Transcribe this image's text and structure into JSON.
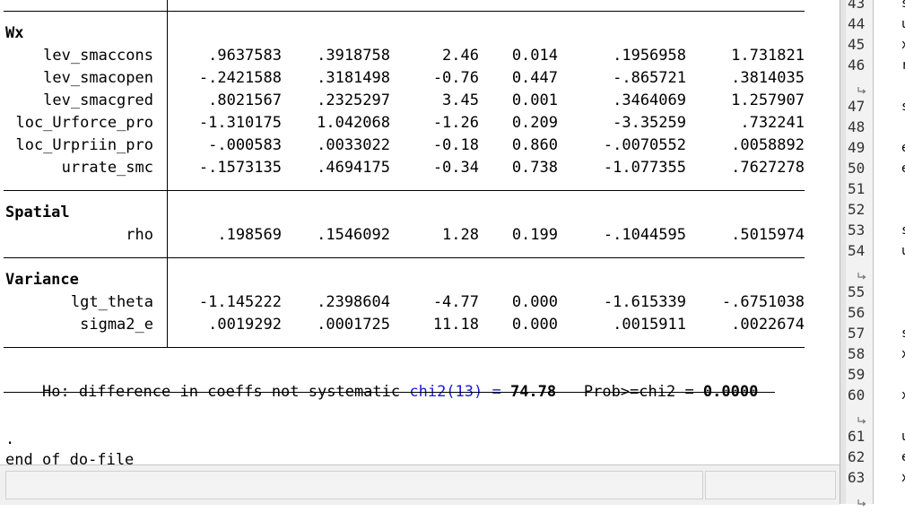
{
  "results": {
    "sections": [
      {
        "title": "Wx",
        "rows": [
          {
            "name": "lev_smaccons",
            "coef": ".9637583",
            "se": ".3918758",
            "z": "2.46",
            "p": "0.014",
            "ci_low": ".1956958",
            "ci_high": "1.731821"
          },
          {
            "name": "lev_smacopen",
            "coef": "-.2421588",
            "se": ".3181498",
            "z": "-0.76",
            "p": "0.447",
            "ci_low": "-.865721",
            "ci_high": ".3814035"
          },
          {
            "name": "lev_smacgred",
            "coef": ".8021567",
            "se": ".2325297",
            "z": "3.45",
            "p": "0.001",
            "ci_low": ".3464069",
            "ci_high": "1.257907"
          },
          {
            "name": "loc_Urforce_pro",
            "coef": "-1.310175",
            "se": "1.042068",
            "z": "-1.26",
            "p": "0.209",
            "ci_low": "-3.35259",
            "ci_high": ".732241"
          },
          {
            "name": "loc_Urpriin_pro",
            "coef": "-.000583",
            "se": ".0033022",
            "z": "-0.18",
            "p": "0.860",
            "ci_low": "-.0070552",
            "ci_high": ".0058892"
          },
          {
            "name": "urrate_smc",
            "coef": "-.1573135",
            "se": ".4694175",
            "z": "-0.34",
            "p": "0.738",
            "ci_low": "-1.077355",
            "ci_high": ".7627278"
          }
        ]
      },
      {
        "title": "Spatial",
        "rows": [
          {
            "name": "rho",
            "coef": ".198569",
            "se": ".1546092",
            "z": "1.28",
            "p": "0.199",
            "ci_low": "-.1044595",
            "ci_high": ".5015974"
          }
        ]
      },
      {
        "title": "Variance",
        "rows": [
          {
            "name": "lgt_theta",
            "coef": "-1.145222",
            "se": ".2398604",
            "z": "-4.77",
            "p": "0.000",
            "ci_low": "-1.615339",
            "ci_high": "-.6751038"
          },
          {
            "name": "sigma2_e",
            "coef": ".0019292",
            "se": ".0001725",
            "z": "11.18",
            "p": "0.000",
            "ci_low": ".0015911",
            "ci_high": ".0022674"
          }
        ]
      }
    ],
    "hausman": {
      "prefix": "Ho: difference in coeffs not systematic ",
      "chi2_label": "chi2(13) = ",
      "chi2_value": "74.78",
      "prob_label": "Prob>=chi2 = ",
      "prob_value": "0.0000"
    },
    "dot": ".",
    "end_text": "end of do-file"
  },
  "editor": {
    "line_numbers": [
      "43",
      "44",
      "45",
      "46",
      "",
      "47",
      "48",
      "49",
      "50",
      "51",
      "52",
      "53",
      "54",
      "",
      "55",
      "56",
      "57",
      "58",
      "59",
      "60",
      "",
      "61",
      "62",
      "63",
      ""
    ],
    "text_fragments": [
      "s",
      "u",
      "x",
      "r",
      "",
      "s",
      "",
      "e",
      "e",
      "",
      "",
      "s",
      "u",
      "",
      "",
      "",
      "s",
      "x",
      "",
      "x",
      "",
      "u",
      "e",
      "x",
      ""
    ]
  }
}
